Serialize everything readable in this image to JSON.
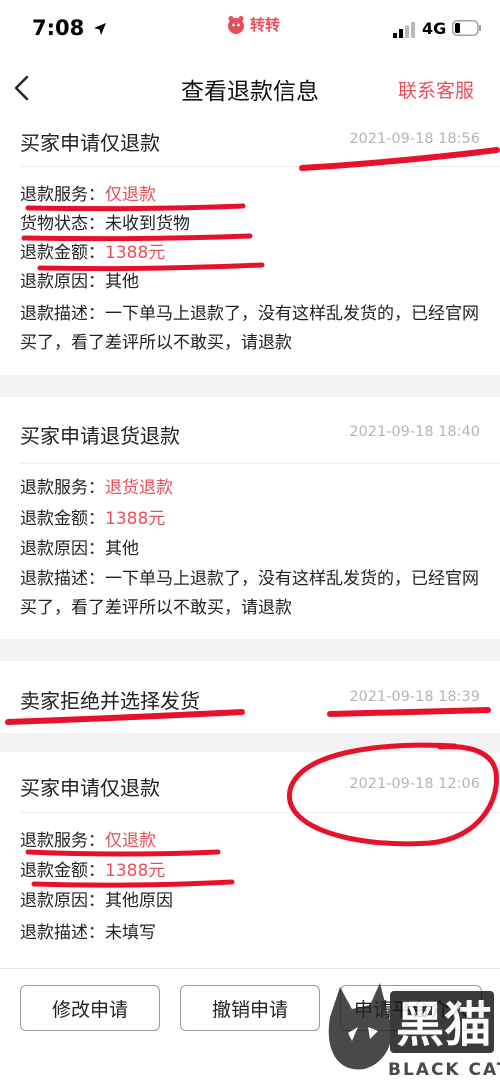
{
  "status_bar": {
    "time": "7:08",
    "app_name": "转转",
    "network": "4G",
    "icons": [
      "location-arrow-icon",
      "signal-icon",
      "battery-icon"
    ]
  },
  "header": {
    "title": "查看退款信息",
    "customer_service": "联系客服",
    "back_icon": "chevron-left-icon"
  },
  "colors": {
    "accent": "#e94e59",
    "annotation_red": "#e8112a",
    "muted": "#b5b5b5"
  },
  "events": [
    {
      "title": "买家申请仅退款",
      "time": "2021-09-18 18:56",
      "rows": [
        {
          "label": "退款服务：",
          "value": "仅退款",
          "red": true
        },
        {
          "label": "货物状态：",
          "value": "未收到货物",
          "red": false
        },
        {
          "label": "退款金额：",
          "value": "1388元",
          "red": true
        },
        {
          "label": "退款原因：",
          "value": "其他",
          "red": false
        },
        {
          "label": "退款描述：",
          "value": "一下单马上退款了，没有这样乱发货的，已经官网买了，看了差评所以不敢买，请退款",
          "red": false
        }
      ]
    },
    {
      "title": "买家申请退货退款",
      "time": "2021-09-18 18:40",
      "rows": [
        {
          "label": "退款服务：",
          "value": "退货退款",
          "red": true
        },
        {
          "label": "退款金额：",
          "value": "1388元",
          "red": true
        },
        {
          "label": "退款原因：",
          "value": "其他",
          "red": false
        },
        {
          "label": "退款描述：",
          "value": "一下单马上退款了，没有这样乱发货的，已经官网买了，看了差评所以不敢买，请退款",
          "red": false
        }
      ]
    },
    {
      "title": "卖家拒绝并选择发货",
      "time": "2021-09-18 18:39",
      "rows": []
    },
    {
      "title": "买家申请仅退款",
      "time": "2021-09-18 12:06",
      "rows": [
        {
          "label": "退款服务：",
          "value": "仅退款",
          "red": true
        },
        {
          "label": "退款金额：",
          "value": "1388元",
          "red": true
        },
        {
          "label": "退款原因：",
          "value": "其他原因",
          "red": false
        },
        {
          "label": "退款描述：",
          "value": "未填写",
          "red": false
        }
      ]
    }
  ],
  "actions": {
    "modify": "修改申请",
    "cancel": "撤销申请",
    "platform": "申请平台介入"
  },
  "watermark": {
    "logo_text": "黑猫",
    "caption": "BLACK CAT"
  }
}
